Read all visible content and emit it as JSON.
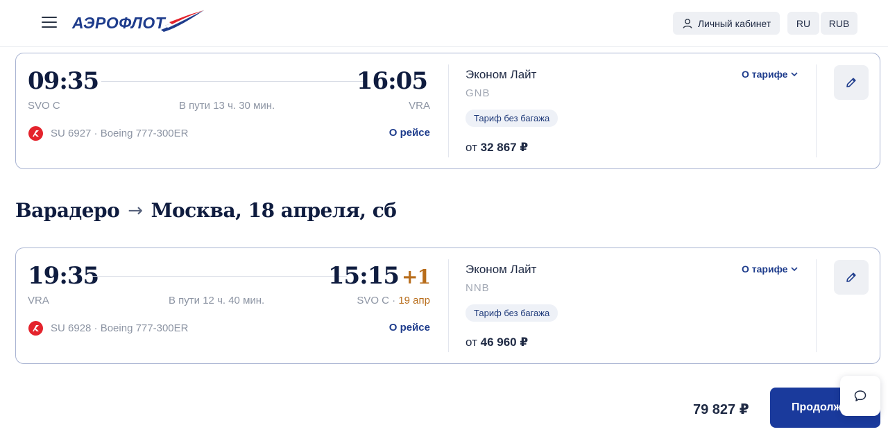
{
  "header": {
    "logo_text": "АЭРОФЛОТ",
    "cabinet_label": "Личный кабинет",
    "language": "RU",
    "currency": "RUB"
  },
  "flights": [
    {
      "dep_time": "09:35",
      "arr_time": "16:05",
      "arr_plus": "",
      "dep_code": "SVO C",
      "arr_code": "VRA",
      "arr_date": "",
      "duration": "В пути 13 ч. 30 мин.",
      "flight_info": "SU 6927 · Boeing 777-300ER",
      "about_label": "О рейсе",
      "fare_name": "Эконом Лайт",
      "fare_code": "GNB",
      "fare_badge": "Тариф без багажа",
      "price_prefix": "от",
      "price": "32 867 ₽",
      "about_fare_label": "О тарифе"
    },
    {
      "dep_time": "19:35",
      "arr_time": "15:15",
      "arr_plus": "+1",
      "dep_code": "VRA",
      "arr_code": "SVO C ·",
      "arr_date": "19 апр",
      "duration": "В пути 12 ч. 40 мин.",
      "flight_info": "SU 6928 · Boeing 777-300ER",
      "about_label": "О рейсе",
      "fare_name": "Эконом Лайт",
      "fare_code": "NNB",
      "fare_badge": "Тариф без багажа",
      "price_prefix": "от",
      "price": "46 960 ₽",
      "about_fare_label": "О тарифе"
    }
  ],
  "return_section": {
    "from": "Варадеро",
    "arrow": "→",
    "to": "Москва, 18 апреля, сб"
  },
  "footer": {
    "total": "79 827 ₽",
    "continue_label": "Продолжить"
  },
  "colors": {
    "brand_blue": "#1a3a9c",
    "accent_orange": "#b86d1b",
    "airline_red": "#e4232c"
  }
}
